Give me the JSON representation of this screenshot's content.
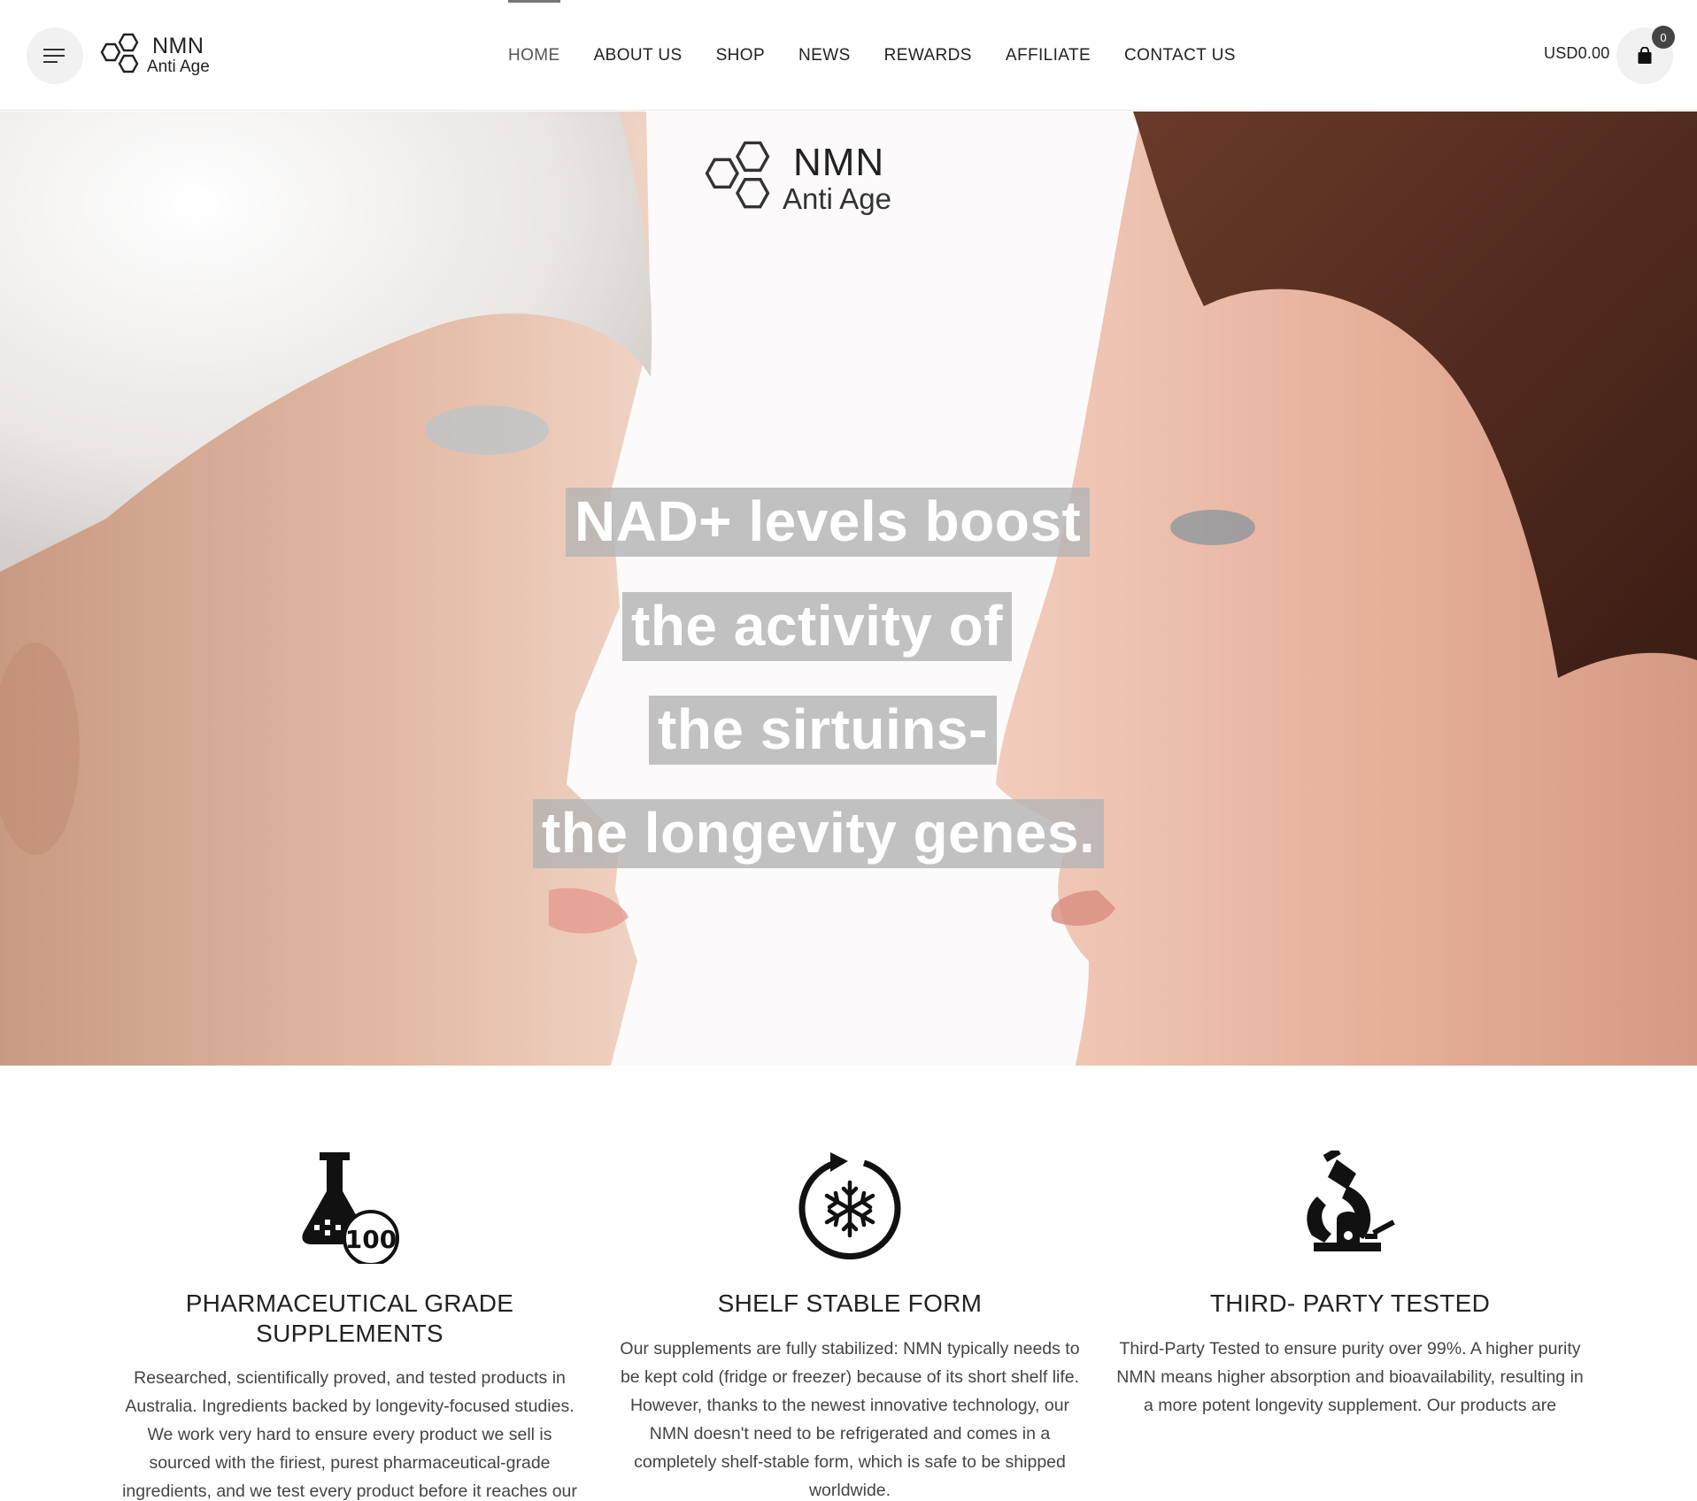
{
  "header": {
    "logo": {
      "line1": "NMN",
      "line2": "Anti Age"
    },
    "nav": [
      {
        "label": "HOME",
        "active": true
      },
      {
        "label": "ABOUT US"
      },
      {
        "label": "SHOP"
      },
      {
        "label": "NEWS"
      },
      {
        "label": "REWARDS"
      },
      {
        "label": "AFFILIATE"
      },
      {
        "label": "CONTACT US"
      }
    ],
    "cart": {
      "amount": "USD0.00",
      "count": "0"
    }
  },
  "hero": {
    "logo": {
      "line1": "NMN",
      "line2": "Anti Age"
    },
    "lines": [
      "NAD+ levels boost",
      "the activity of",
      "the sirtuins-",
      "the longevity genes."
    ]
  },
  "features": [
    {
      "icon": "flask-100-icon",
      "badge": "100",
      "title": "PHARMACEUTICAL GRADE SUPPLEMENTS",
      "text": "Researched, scientifically proved, and tested products in Australia. Ingredients backed by longevity-focused studies. We work very hard to ensure every product we sell is sourced with the firiest, purest pharmaceutical-grade ingredients, and we test every product before it reaches our customer's hands."
    },
    {
      "icon": "snowflake-cycle-icon",
      "title": "SHELF STABLE FORM",
      "text": "Our supplements are fully stabilized: NMN typically needs to be kept cold (fridge or freezer) because of its short shelf life. However, thanks to the newest innovative technology, our NMN doesn't need to be refrigerated and comes in a completely shelf-stable form, which is safe to be shipped worldwide."
    },
    {
      "icon": "microscope-icon",
      "title": "THIRD- PARTY TESTED",
      "text": "Third-Party Tested to ensure purity over 99%. A higher purity NMN means higher absorption and bioavailability, resulting in a more potent longevity supplement. Our products are"
    }
  ],
  "colors": {
    "accent": "#777777",
    "badge": "#444444",
    "hero_text_bg": "#b4b4b4"
  }
}
